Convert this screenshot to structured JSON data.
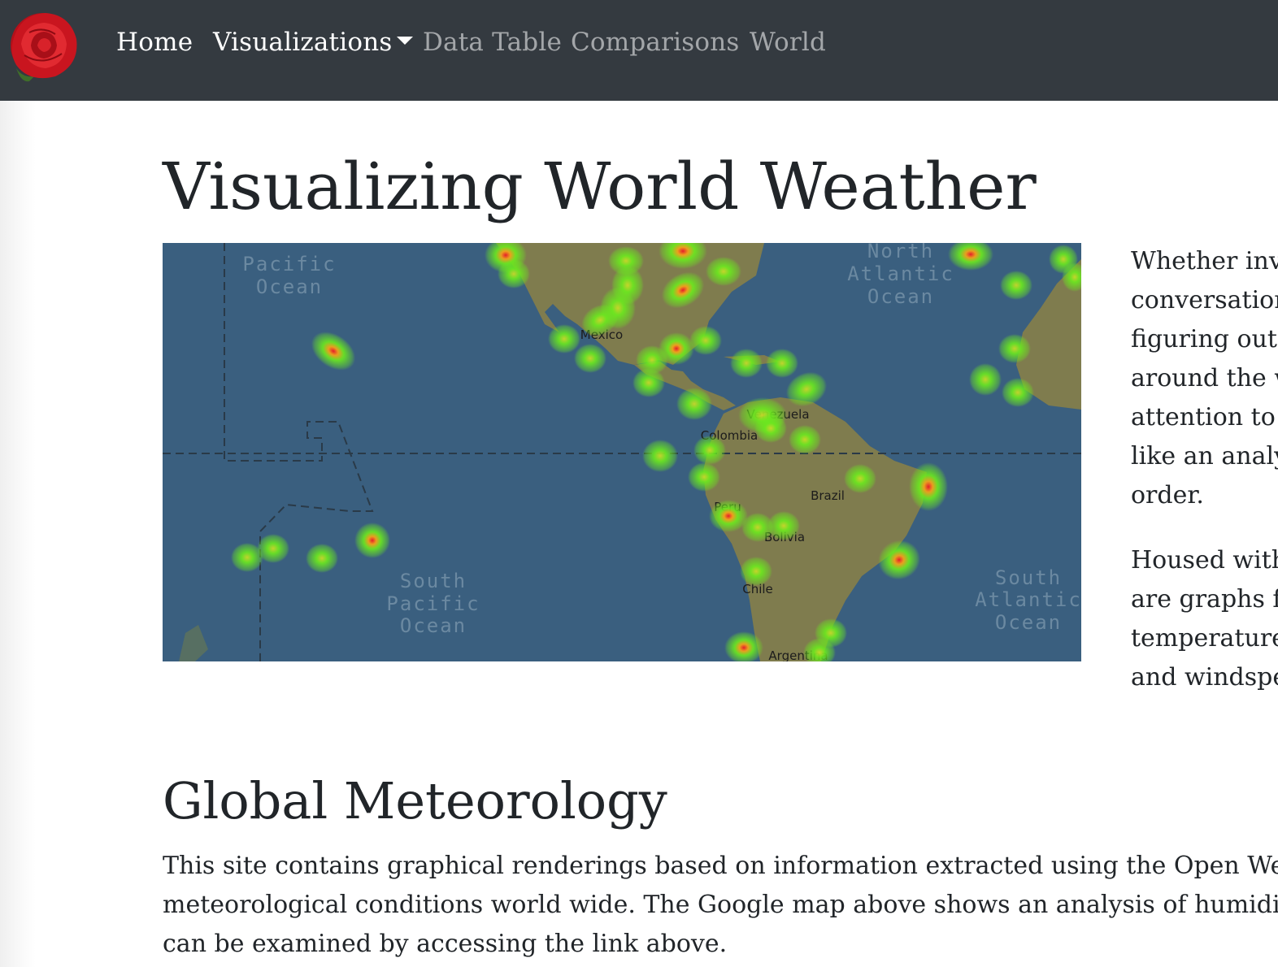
{
  "nav": {
    "items": [
      {
        "label": "Home"
      },
      {
        "label": "Visualizations"
      },
      {
        "label": "Data Table"
      },
      {
        "label": "Comparisons"
      },
      {
        "label": "World"
      }
    ]
  },
  "page": {
    "title": "Visualizing World Weather"
  },
  "map": {
    "labels": {
      "north_pacific": [
        "Pacific",
        "Ocean"
      ],
      "north_atlantic": [
        "North",
        "Atlantic",
        "Ocean"
      ],
      "south_pacific": [
        "South",
        "Pacific",
        "Ocean"
      ],
      "south_atlantic": [
        "South",
        "Atlantic",
        "Ocean"
      ],
      "mexico": "Mexico",
      "venezuela": "Venezuela",
      "colombia": "Colombia",
      "brazil": "Brazil",
      "peru": "Peru",
      "bolivia": "Bolivia",
      "chile": "Chile",
      "argentina": "Argentina"
    }
  },
  "side": {
    "paragraph_1": [
      "Whether inv",
      "conversation",
      "figuring out",
      "around the w",
      "attention to t",
      "like an analy",
      "order."
    ],
    "paragraph_2": [
      "Housed with",
      "are graphs fr",
      "temperatures",
      "and windspe"
    ]
  },
  "section": {
    "title": "Global Meteorology",
    "body": [
      "This site contains graphical renderings based on information extracted using the Open Weather M",
      "meteorological conditions world wide. The Google map above shows an analysis of humidity lev",
      "can be examined by accessing the link above."
    ]
  },
  "colors": {
    "navbar": "#343a40",
    "ocean": "#3a5f7f",
    "land": "#7f7c4e",
    "heat_low": "#6bea1e",
    "heat_mid": "#f2a11b",
    "heat_high": "#e61d2a"
  }
}
